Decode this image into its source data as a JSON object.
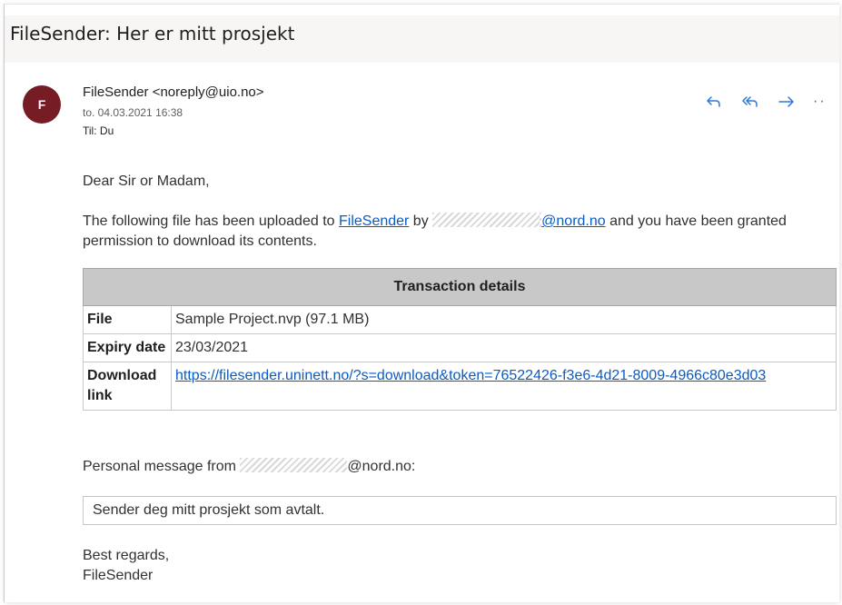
{
  "subject": "FileSender: Her er mitt prosjekt",
  "sender": {
    "avatar_letter": "F",
    "from": "FileSender <noreply@uio.no>",
    "date": "to. 04.03.2021 16:38",
    "to_label": "Til:",
    "to_value": "Du"
  },
  "actions": {
    "reply": "reply-icon",
    "reply_all": "reply-all-icon",
    "forward": "forward-icon",
    "more": "··"
  },
  "body": {
    "greeting": "Dear Sir or Madam,",
    "para_1": "The following file has been uploaded to ",
    "filesender_link": "FileSender",
    "para_2": " by ",
    "uploader_email_visible": "@nord.no",
    "para_3": " and you have been granted permission to download its contents.",
    "table": {
      "header": "Transaction details",
      "rows": [
        {
          "key": "File",
          "value": "Sample Project.nvp (97.1 MB)"
        },
        {
          "key": "Expiry date",
          "value": "23/03/2021"
        },
        {
          "key": "Download link",
          "value": "https://filesender.uninett.no/?s=download&token=76522426-f3e6-4d21-8009-4966c80e3d03"
        }
      ]
    },
    "pm_prefix": "Personal message from ",
    "pm_suffix": "@nord.no:",
    "personal_message": "Sender deg mitt prosjekt som avtalt.",
    "regards": "Best regards,",
    "signature": "FileSender"
  },
  "colors": {
    "avatar": "#751c25",
    "link": "#0b5bc5",
    "icon": "#2b78d6"
  }
}
